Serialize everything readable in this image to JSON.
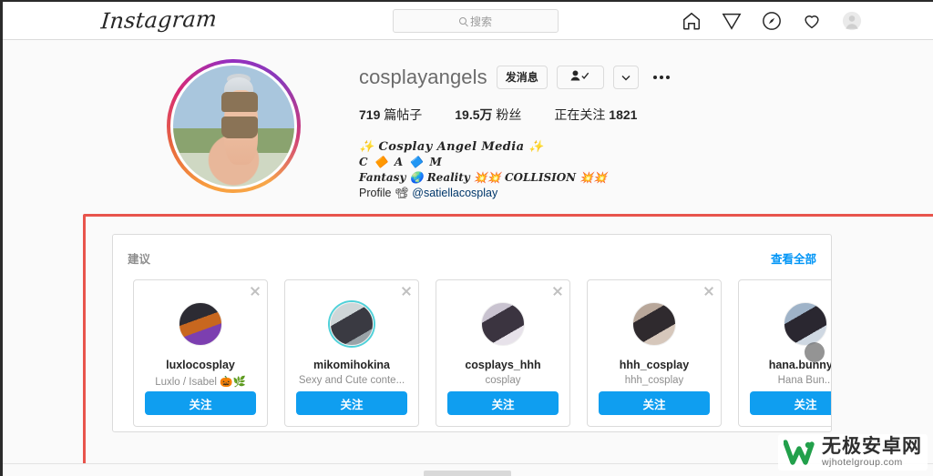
{
  "nav": {
    "logo_text": "Instagram",
    "search_placeholder": "搜索",
    "search_value": "",
    "icons": [
      {
        "name": "home-icon",
        "label": "主页"
      },
      {
        "name": "paper-plane-icon",
        "label": "私信"
      },
      {
        "name": "compass-icon",
        "label": "探索"
      },
      {
        "name": "heart-icon",
        "label": "动态"
      },
      {
        "name": "avatar-icon",
        "label": "个人主页"
      }
    ]
  },
  "profile": {
    "username": "cosplayangels",
    "message_button": "发消息",
    "following_icon": "person-check-icon",
    "caret_icon": "chevron-down-icon",
    "more_icon": "more-options-icon",
    "stats": {
      "posts_count": "719",
      "posts_label": "篇帖子",
      "followers_count": "19.5万",
      "followers_label": "粉丝",
      "following_label": "正在关注",
      "following_count": "1821"
    },
    "bio": {
      "line1": "✨ Cosplay Angel Media ✨",
      "line2": "C 🔶 A 🔷 M",
      "line3": "Fantasy 🌏 Reality 💥💥 COLLISION 💥💥",
      "line4_prefix": "Profile 📽 ",
      "line4_handle": "@satiellacosplay"
    }
  },
  "suggestions": {
    "title": "建议",
    "see_all": "查看全部",
    "follow_label": "关注",
    "close_label": "×",
    "cards": [
      {
        "username": "luxlocosplay",
        "subtitle": "Luxlo / Isabel 🎃🌿",
        "avatar": "ph1",
        "ring": false
      },
      {
        "username": "mikomihokina",
        "subtitle": "Sexy and Cute conte...",
        "avatar": "ph2",
        "ring": true
      },
      {
        "username": "cosplays_hhh",
        "subtitle": "cosplay",
        "avatar": "ph3",
        "ring": false
      },
      {
        "username": "hhh_cosplay",
        "subtitle": "hhh_cosplay",
        "avatar": "ph4",
        "ring": false
      },
      {
        "username": "hana.bunny_l",
        "subtitle": "Hana Bun...",
        "avatar": "ph5",
        "ring": false
      }
    ]
  },
  "annotation": {
    "color": "#e8544c",
    "shape": "rectangle-highlight"
  },
  "watermark": {
    "brand_cn": "无极安卓网",
    "url": "wjhotelgroup.com",
    "logo_color": "#22a04b"
  }
}
